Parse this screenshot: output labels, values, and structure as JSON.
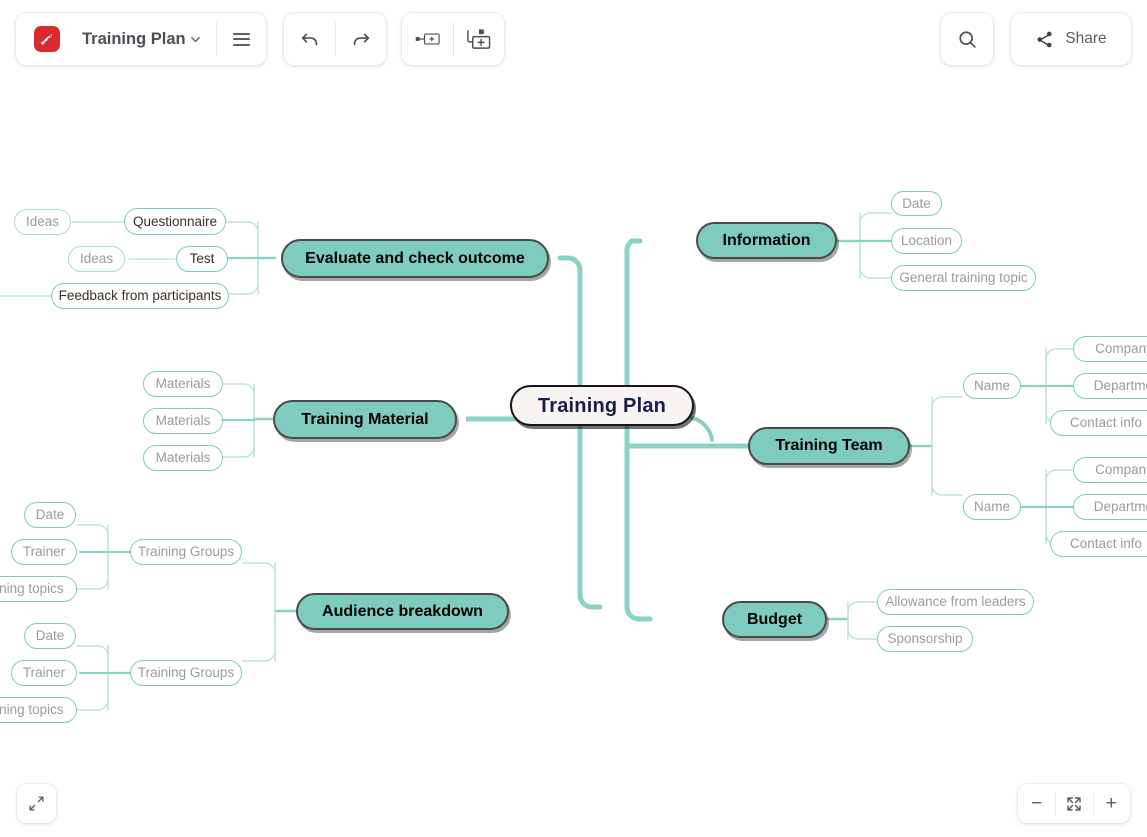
{
  "toolbar": {
    "logo_icon": "app-logo-icon",
    "doc_title": "Training Plan",
    "doc_title_chevron": "chevron-down-icon",
    "menu_icon": "hamburger-menu-icon",
    "undo_icon": "undo-arrow-icon",
    "redo_icon": "redo-arrow-icon",
    "insert_sibling_icon": "add-sibling-node-icon",
    "insert_child_icon": "add-child-node-icon",
    "search_icon": "search-icon",
    "share_icon": "share-icon",
    "share_label": "Share"
  },
  "bottom": {
    "fullscreen_icon": "expand-fullscreen-icon",
    "zoom_out_label": "−",
    "fit_icon": "fit-to-screen-icon",
    "zoom_in_label": "+"
  },
  "mindmap": {
    "root": "Training Plan",
    "branches": {
      "evaluate": {
        "label": "Evaluate and check outcome",
        "children": [
          {
            "label": "Questionnaire",
            "filled": true,
            "children": [
              {
                "label": "Ideas",
                "filled": false
              }
            ]
          },
          {
            "label": "Test",
            "filled": true,
            "children": [
              {
                "label": "Ideas",
                "filled": false
              }
            ]
          },
          {
            "label": "Feedback from participants",
            "filled": true,
            "children": []
          }
        ]
      },
      "training_material": {
        "label": "Training Material",
        "children": [
          {
            "label": "Materials",
            "filled": false
          },
          {
            "label": "Materials",
            "filled": false
          },
          {
            "label": "Materials",
            "filled": false
          }
        ]
      },
      "audience": {
        "label": "Audience breakdown",
        "children": [
          {
            "label": "Training Groups",
            "filled": false,
            "children": [
              {
                "label": "Date",
                "filled": false
              },
              {
                "label": "Trainer",
                "filled": false
              },
              {
                "label": "Training topics",
                "filled": false
              }
            ]
          },
          {
            "label": "Training Groups",
            "filled": false,
            "children": [
              {
                "label": "Date",
                "filled": false
              },
              {
                "label": "Trainer",
                "filled": false
              },
              {
                "label": "Training topics",
                "filled": false
              }
            ]
          }
        ]
      },
      "information": {
        "label": "Information",
        "children": [
          {
            "label": "Date",
            "filled": false
          },
          {
            "label": "Location",
            "filled": false
          },
          {
            "label": "General training topic",
            "filled": false
          }
        ]
      },
      "training_team": {
        "label": "Training Team",
        "children": [
          {
            "label": "Name",
            "filled": false,
            "children": [
              {
                "label": "Company",
                "filled": false
              },
              {
                "label": "Department",
                "filled": false
              },
              {
                "label": "Contact info",
                "filled": false
              }
            ]
          },
          {
            "label": "Name",
            "filled": false,
            "children": [
              {
                "label": "Company",
                "filled": false
              },
              {
                "label": "Department",
                "filled": false
              },
              {
                "label": "Contact info",
                "filled": false
              }
            ]
          }
        ]
      },
      "budget": {
        "label": "Budget",
        "children": [
          {
            "label": "Allowance from leaders",
            "filled": false
          },
          {
            "label": "Sponsorship",
            "filled": false
          }
        ]
      }
    }
  },
  "colors": {
    "node_teal": "#7dccbe",
    "connector_teal": "#8ad2c4",
    "connector_light": "#bfe4dc",
    "root_fill": "#f7f3f0",
    "root_text": "#1b1b4d",
    "logo_red": "#d92b2b",
    "placeholder_text": "#9b9b9b"
  }
}
